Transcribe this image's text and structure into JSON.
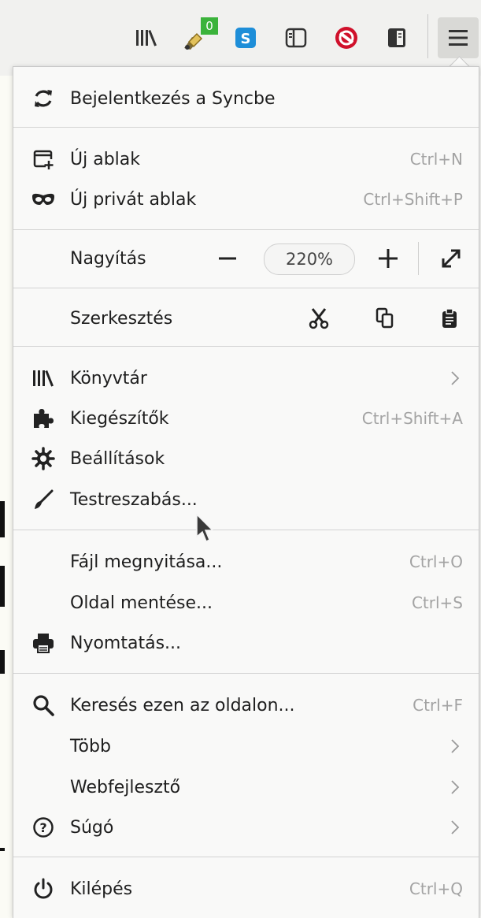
{
  "toolbar": {
    "badge_count": "0",
    "icons": [
      "library-icon",
      "extension-addon-icon",
      "skype-icon",
      "reader-view-icon",
      "block-icon",
      "sidebar-icon",
      "hamburger-menu-icon"
    ]
  },
  "menu": {
    "sync_label": "Bejelentkezés a Syncbe",
    "new_window": {
      "label": "Új ablak",
      "shortcut": "Ctrl+N"
    },
    "private_window": {
      "label": "Új privát ablak",
      "shortcut": "Ctrl+Shift+P"
    },
    "zoom": {
      "label": "Nagyítás",
      "minus": "−",
      "value": "220%",
      "plus": "+"
    },
    "edit": {
      "label": "Szerkesztés"
    },
    "library": {
      "label": "Könyvtár"
    },
    "addons": {
      "label": "Kiegészítők",
      "shortcut": "Ctrl+Shift+A"
    },
    "settings": {
      "label": "Beállítások"
    },
    "customize": {
      "label": "Testreszabás..."
    },
    "open_file": {
      "label": "Fájl megnyitása...",
      "shortcut": "Ctrl+O"
    },
    "save_page": {
      "label": "Oldal mentése...",
      "shortcut": "Ctrl+S"
    },
    "print": {
      "label": "Nyomtatás..."
    },
    "find": {
      "label": "Keresés ezen az oldalon...",
      "shortcut": "Ctrl+F"
    },
    "more": {
      "label": "Több"
    },
    "webdev": {
      "label": "Webfejlesztő"
    },
    "help": {
      "label": "Súgó"
    },
    "quit": {
      "label": "Kilépés",
      "shortcut": "Ctrl+Q"
    }
  },
  "colors": {
    "accent_green": "#3bb33b",
    "skype_blue": "#1e8ed8",
    "block_red": "#d0112b"
  }
}
